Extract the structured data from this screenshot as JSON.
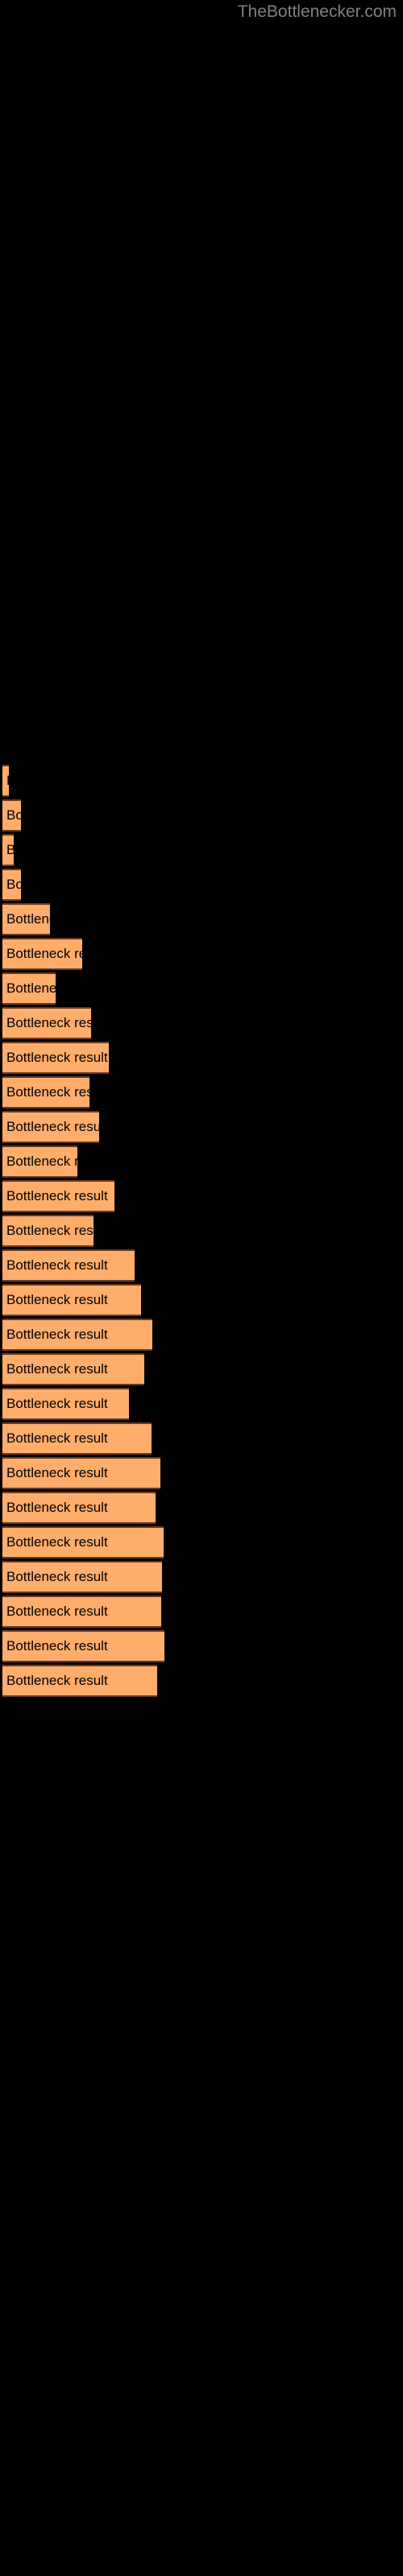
{
  "watermark": "TheBottlenecker.com",
  "colors": {
    "background": "#000000",
    "bar_fill": "#ffad6b",
    "bar_stroke": "#6b3a1e",
    "label_text": "#000000",
    "watermark_text": "#808080"
  },
  "chart_data": {
    "type": "bar",
    "orientation": "horizontal",
    "title": "",
    "subtitle": "",
    "xlabel": "",
    "ylabel": "",
    "grid": false,
    "legend": null,
    "xlim": [
      0,
      500
    ],
    "bar_label_text": "Bottleneck result",
    "categories": [
      "Bottleneck result",
      "Bottleneck result",
      "Bottleneck result",
      "Bottleneck result",
      "Bottleneck result",
      "Bottleneck result",
      "Bottleneck result",
      "Bottleneck result",
      "Bottleneck result",
      "Bottleneck result",
      "Bottleneck result",
      "Bottleneck result",
      "Bottleneck result",
      "Bottleneck result",
      "Bottleneck result",
      "Bottleneck result",
      "Bottleneck result",
      "Bottleneck result",
      "Bottleneck result",
      "Bottleneck result",
      "Bottleneck result",
      "Bottleneck result",
      "Bottleneck result",
      "Bottleneck result",
      "Bottleneck result",
      "Bottleneck result",
      "Bottleneck result"
    ],
    "values": [
      8,
      23,
      14,
      23,
      59,
      99,
      66,
      110,
      132,
      108,
      120,
      93,
      139,
      113,
      164,
      172,
      186,
      176,
      157,
      185,
      196,
      190,
      200,
      198,
      197,
      201,
      192
    ],
    "bar_tops": [
      950,
      993,
      1036,
      1079,
      1122,
      1165,
      1208,
      1251,
      1294,
      1337,
      1380,
      1423,
      1466,
      1509,
      1552,
      1595,
      1638,
      1681,
      1724,
      1767,
      1810,
      1853,
      1896,
      1939,
      1982,
      2025,
      2068
    ]
  }
}
